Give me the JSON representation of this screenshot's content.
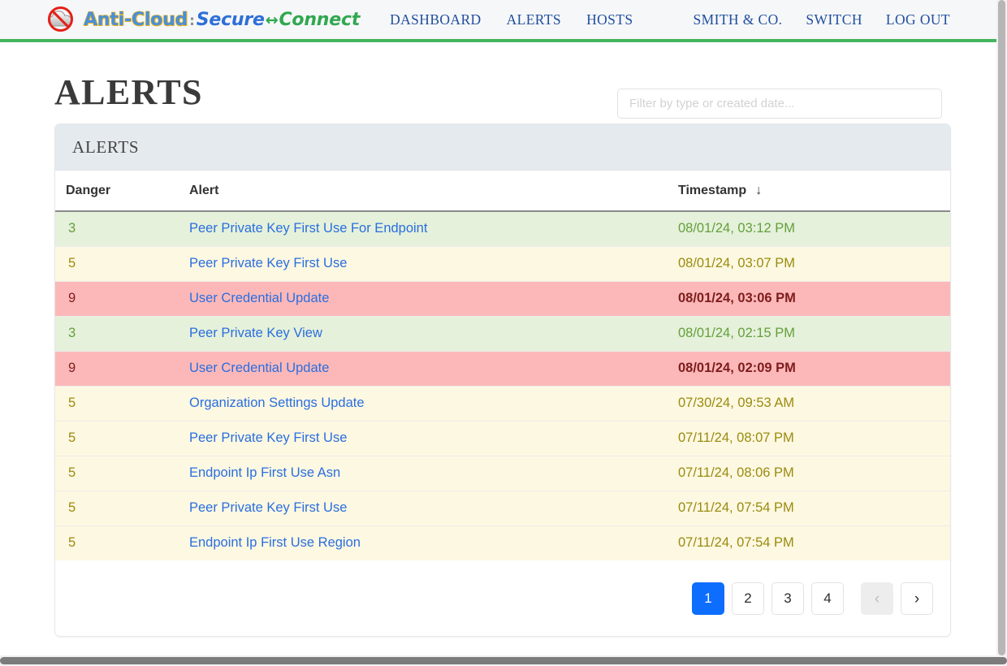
{
  "brand": {
    "logo_icon": "no-cloud-icon",
    "anti_cloud": "Anti-Cloud",
    "separator": ":",
    "secure": "Secure",
    "arrow": "↔",
    "connect": "Connect"
  },
  "nav": {
    "primary": [
      {
        "label": "DASHBOARD",
        "name": "nav-dashboard"
      },
      {
        "label": "ALERTS",
        "name": "nav-alerts"
      },
      {
        "label": "HOSTS",
        "name": "nav-hosts"
      }
    ],
    "secondary": [
      {
        "label": "SMITH & CO.",
        "name": "nav-org-smith-and-co"
      },
      {
        "label": "SWITCH",
        "name": "nav-switch"
      },
      {
        "label": "LOG OUT",
        "name": "nav-log-out"
      }
    ]
  },
  "page": {
    "title": "ALERTS"
  },
  "filter": {
    "placeholder": "Filter by type or created date...",
    "value": ""
  },
  "card": {
    "title": "ALERTS"
  },
  "table": {
    "columns": {
      "danger": "Danger",
      "alert": "Alert",
      "timestamp": "Timestamp"
    },
    "sort": {
      "column": "Timestamp",
      "direction_icon": "↓"
    },
    "rows": [
      {
        "danger": "3",
        "alert": "Peer Private Key First Use For Endpoint",
        "timestamp": "08/01/24, 03:12 PM",
        "level": "lvl-low"
      },
      {
        "danger": "5",
        "alert": "Peer Private Key First Use",
        "timestamp": "08/01/24, 03:07 PM",
        "level": "lvl-med"
      },
      {
        "danger": "9",
        "alert": "User Credential Update",
        "timestamp": "08/01/24, 03:06 PM",
        "level": "lvl-high"
      },
      {
        "danger": "3",
        "alert": "Peer Private Key View",
        "timestamp": "08/01/24, 02:15 PM",
        "level": "lvl-low"
      },
      {
        "danger": "9",
        "alert": "User Credential Update",
        "timestamp": "08/01/24, 02:09 PM",
        "level": "lvl-high"
      },
      {
        "danger": "5",
        "alert": "Organization Settings Update",
        "timestamp": "07/30/24, 09:53 AM",
        "level": "lvl-med"
      },
      {
        "danger": "5",
        "alert": "Peer Private Key First Use",
        "timestamp": "07/11/24, 08:07 PM",
        "level": "lvl-med"
      },
      {
        "danger": "5",
        "alert": "Endpoint Ip First Use Asn",
        "timestamp": "07/11/24, 08:06 PM",
        "level": "lvl-med"
      },
      {
        "danger": "5",
        "alert": "Peer Private Key First Use",
        "timestamp": "07/11/24, 07:54 PM",
        "level": "lvl-med"
      },
      {
        "danger": "5",
        "alert": "Endpoint Ip First Use Region",
        "timestamp": "07/11/24, 07:54 PM",
        "level": "lvl-med"
      }
    ]
  },
  "pagination": {
    "pages": [
      {
        "label": "1",
        "state": "active"
      },
      {
        "label": "2",
        "state": ""
      },
      {
        "label": "3",
        "state": ""
      },
      {
        "label": "4",
        "state": ""
      }
    ],
    "prev_label": "‹",
    "next_label": "›",
    "prev_state": "disabled",
    "next_state": ""
  },
  "colors": {
    "accent_green": "#45b45e",
    "link_blue": "#2a6ee0",
    "active_page_blue": "#0d6efd",
    "level_low_bg": "#e5f1da",
    "level_med_bg": "#fdf8e1",
    "level_high_bg": "#fcb8b8",
    "card_head_bg": "#e5eaef",
    "topbar_bg": "#f6f7f9"
  }
}
